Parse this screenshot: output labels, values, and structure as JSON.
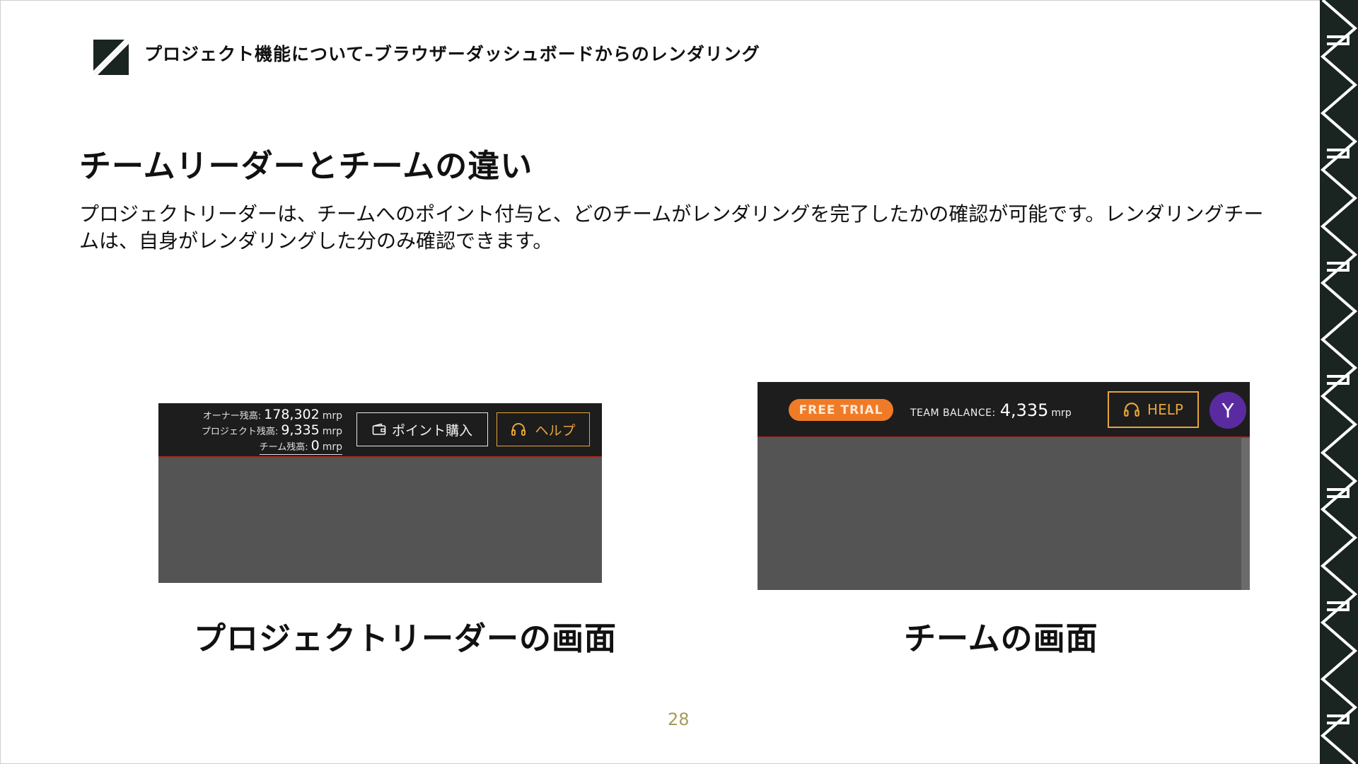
{
  "header": {
    "title": "プロジェクト機能について–ブラウザーダッシュボードからのレンダリング"
  },
  "section": {
    "heading": "チームリーダーとチームの違い",
    "body": "プロジェクトリーダーは、チームへのポイント付与と、どのチームがレンダリングを完了したかの確認が可能です。レンダリングチームは、自身がレンダリングした分のみ確認できます。"
  },
  "leader_screen": {
    "balances": [
      {
        "label": "オーナー残高",
        "value": "178,302",
        "unit": "mrp"
      },
      {
        "label": "プロジェクト残高",
        "value": "9,335",
        "unit": "mrp"
      },
      {
        "label": "チーム残高",
        "value": "0",
        "unit": "mrp"
      }
    ],
    "buy_points_label": "ポイント購入",
    "help_label": "ヘルプ",
    "caption": "プロジェクトリーダーの画面"
  },
  "team_screen": {
    "badge": "FREE TRIAL",
    "balance_label": "TEAM BALANCE:",
    "balance_value": "4,335",
    "balance_unit": "mrp",
    "help_label": "HELP",
    "avatar_initial": "Y",
    "caption": "チームの画面"
  },
  "page_number": "28",
  "colors": {
    "accent_orange": "#e7a43a",
    "trial_badge": "#f07b26",
    "top_bar": "#1d1d1d",
    "divider_red": "#b3261e",
    "avatar_purple": "#5a2ba0",
    "page_number": "#a59a5a"
  },
  "icons": {
    "header_logo": "diagonal-logo-icon",
    "buy_points": "wallet-icon",
    "help": "headset-icon",
    "side_band": "zigzag-pattern"
  }
}
